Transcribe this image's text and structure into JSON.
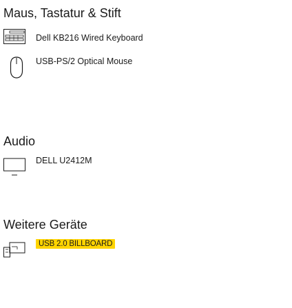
{
  "sections": {
    "input": {
      "title": "Maus, Tastatur & Stift",
      "devices": [
        {
          "name": "Dell KB216 Wired Keyboard",
          "icon": "keyboard-icon"
        },
        {
          "name": "USB-PS/2 Optical Mouse",
          "icon": "mouse-icon"
        }
      ]
    },
    "audio": {
      "title": "Audio",
      "devices": [
        {
          "name": "DELL U2412M",
          "icon": "monitor-icon"
        }
      ]
    },
    "other": {
      "title": "Weitere Geräte",
      "devices": [
        {
          "name": "USB 2.0 BILLBOARD",
          "icon": "usb-device-icon",
          "highlight_color": "#ffd400"
        }
      ]
    }
  }
}
